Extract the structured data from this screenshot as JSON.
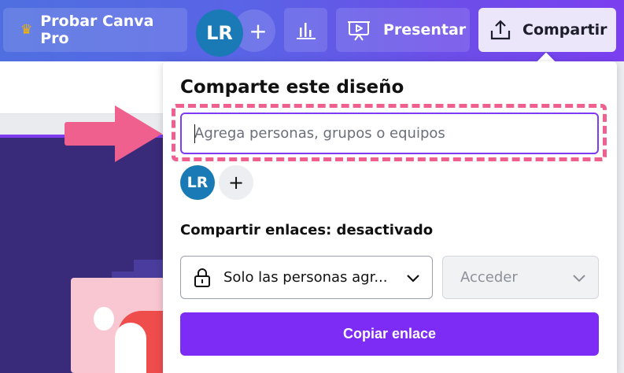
{
  "toolbar": {
    "try_pro_label": "Probar Canva Pro",
    "avatar_initials": "LR",
    "add_people_symbol": "+",
    "present_label": "Presentar",
    "share_label": "Compartir"
  },
  "share_panel": {
    "title": "Comparte este diseño",
    "invite_placeholder": "Agrega personas, grupos o equipos",
    "invite_value": "",
    "member_initials": "LR",
    "add_member_symbol": "+",
    "link_sharing_label": "Compartir enlaces: desactivado",
    "access_option": "Solo las personas agr...",
    "permission_option": "Acceder",
    "copy_link_label": "Copiar enlace"
  },
  "colors": {
    "brand_purple": "#7d2cf6",
    "highlight_pink": "#f0608f",
    "avatar_blue": "#1a7ab5"
  },
  "icons": [
    "crown-icon",
    "stats-icon",
    "present-icon",
    "share-upload-icon",
    "lock-icon",
    "chevron-down-icon"
  ]
}
